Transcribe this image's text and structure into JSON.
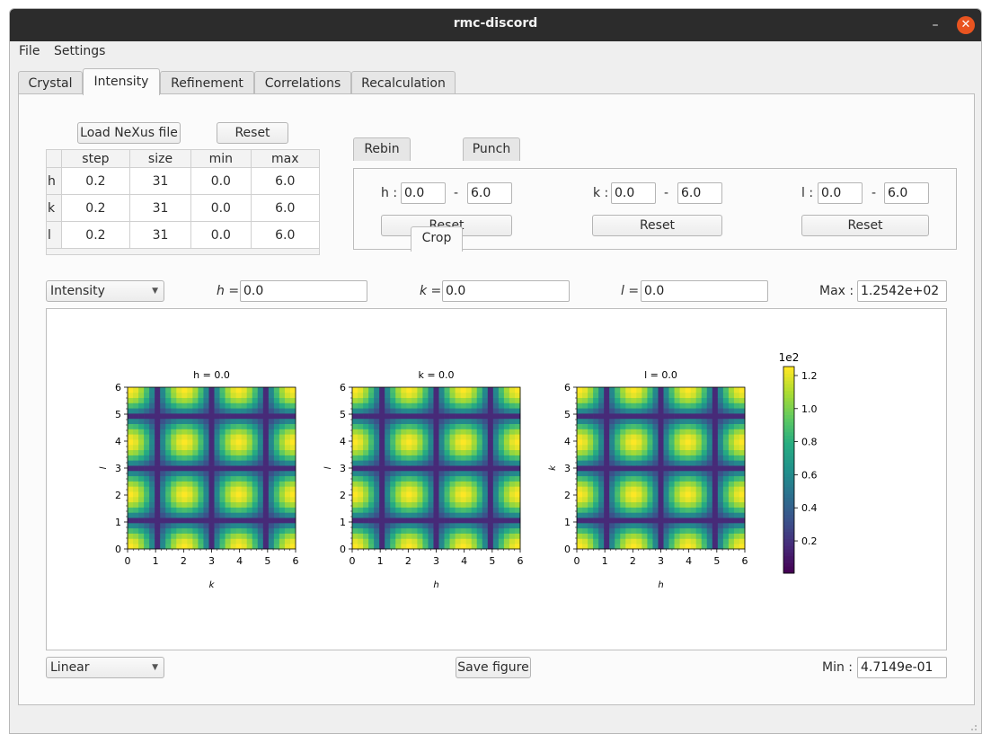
{
  "window": {
    "title": "rmc-discord"
  },
  "menu": [
    "File",
    "Settings"
  ],
  "tabs": [
    "Crystal",
    "Intensity",
    "Refinement",
    "Correlations",
    "Recalculation"
  ],
  "top": {
    "load_label": "Load NeXus file",
    "reset_label": "Reset",
    "table": {
      "headers": [
        "step",
        "size",
        "min",
        "max"
      ],
      "rows": [
        {
          "name": "h",
          "step": "0.2",
          "size": "31",
          "min": "0.0",
          "max": "6.0"
        },
        {
          "name": "k",
          "step": "0.2",
          "size": "31",
          "min": "0.0",
          "max": "6.0"
        },
        {
          "name": "l",
          "step": "0.2",
          "size": "31",
          "min": "0.0",
          "max": "6.0"
        }
      ]
    }
  },
  "subtabs": [
    "Rebin",
    "Crop",
    "Punch"
  ],
  "crop": {
    "h": {
      "label": "h :",
      "min": "0.0",
      "dash": "-",
      "max": "6.0",
      "reset": "Reset"
    },
    "k": {
      "label": "k :",
      "min": "0.0",
      "dash": "-",
      "max": "6.0",
      "reset": "Reset"
    },
    "l": {
      "label": "l :",
      "min": "0.0",
      "dash": "-",
      "max": "6.0",
      "reset": "Reset"
    }
  },
  "controls": {
    "type_select": "Intensity",
    "h_label": "h =",
    "h_value": "0.0",
    "k_label": "k =",
    "k_value": "0.0",
    "l_label": "l =",
    "l_value": "0.0",
    "max_label": "Max :",
    "max_value": "1.2542e+02",
    "scale_select": "Linear",
    "save_label": "Save figure",
    "min_label": "Min :",
    "min_value": "4.7149e-01"
  },
  "chart_data": {
    "type": "heatmap",
    "colormap": "viridis",
    "color_range": [
      0.47149,
      125.42
    ],
    "colorbar_ticks": [
      "0.2",
      "0.4",
      "0.6",
      "0.8",
      "1.0",
      "1.2"
    ],
    "colorbar_multiplier": "1e2",
    "grid_size": 31,
    "axis_range": [
      0,
      6
    ],
    "tick_labels": [
      "0",
      "1",
      "2",
      "3",
      "4",
      "5",
      "6"
    ],
    "panels": [
      {
        "title": "h = 0.0",
        "xlabel": "k",
        "ylabel": "l"
      },
      {
        "title": "k = 0.0",
        "xlabel": "h",
        "ylabel": "l"
      },
      {
        "title": "l = 0.0",
        "xlabel": "h",
        "ylabel": "k"
      }
    ]
  }
}
